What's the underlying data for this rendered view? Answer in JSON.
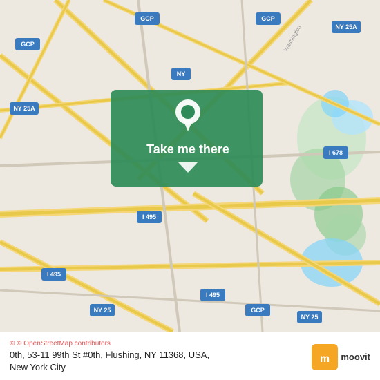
{
  "map": {
    "background_color": "#e8e0d8",
    "center_lat": 40.745,
    "center_lon": -73.85
  },
  "cta": {
    "label": "Take me there",
    "pin_color": "#2e8b57"
  },
  "bottom_bar": {
    "osm_attribution": "© OpenStreetMap contributors",
    "address_line1": "0th, 53-11 99th St #0th, Flushing, NY 11368, USA,",
    "address_line2": "New York City",
    "moovit_label": "moovit"
  },
  "route_badges": [
    {
      "label": "GCP",
      "color": "#3a7abf"
    },
    {
      "label": "GCP",
      "color": "#3a7abf"
    },
    {
      "label": "GCP",
      "color": "#3a7abf"
    },
    {
      "label": "NY 25A",
      "color": "#3a7abf"
    },
    {
      "label": "NY 25A",
      "color": "#3a7abf"
    },
    {
      "label": "NY 25",
      "color": "#3a7abf"
    },
    {
      "label": "NY 25",
      "color": "#3a7abf"
    },
    {
      "label": "I 495",
      "color": "#3a7abf"
    },
    {
      "label": "I 495",
      "color": "#3a7abf"
    },
    {
      "label": "I 495",
      "color": "#3a7abf"
    },
    {
      "label": "I 678",
      "color": "#3a7abf"
    },
    {
      "label": "NY",
      "color": "#3a7abf"
    }
  ]
}
